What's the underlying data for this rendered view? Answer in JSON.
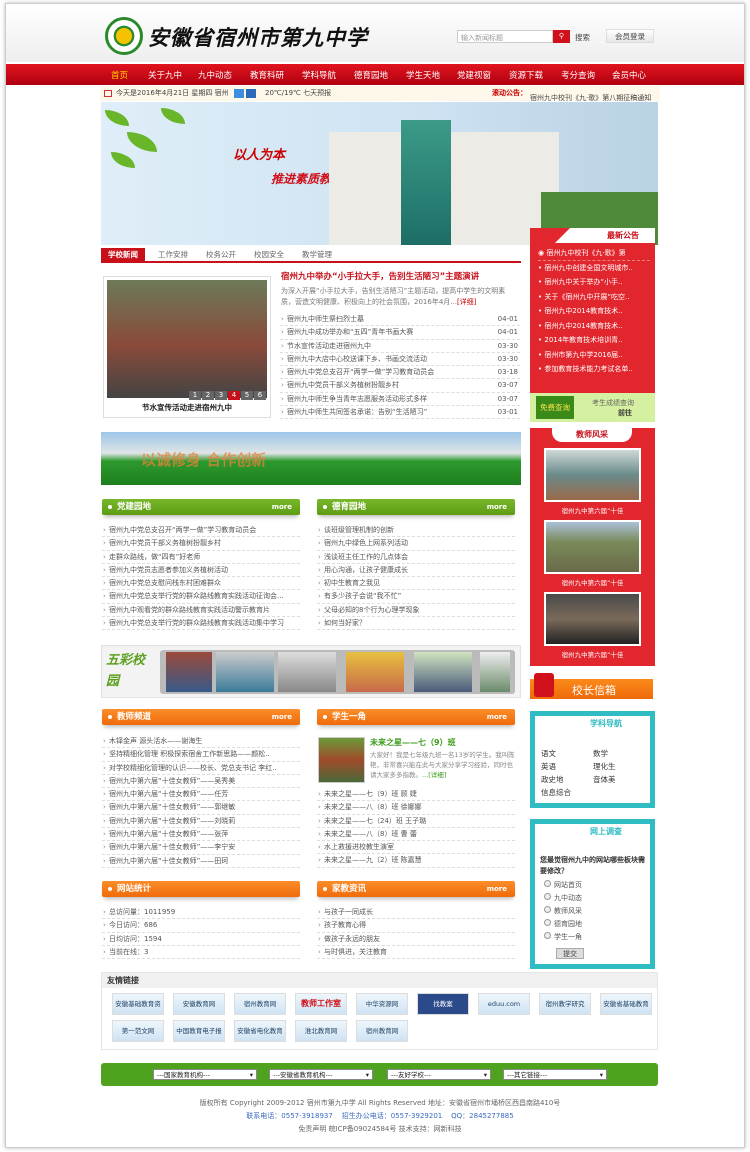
{
  "header": {
    "school_name": "安徽省宿州市第九中学",
    "search_placeholder": "输入新闻标题",
    "search_button": "搜索",
    "login": "会员登录"
  },
  "nav": [
    "首页",
    "关于九中",
    "九中动态",
    "教育科研",
    "学科导航",
    "德育园地",
    "学生天地",
    "党建视窗",
    "资源下载",
    "考分查询",
    "会员中心"
  ],
  "infobar": {
    "date_weather": "今天是2016年4月21日 星期四 宿州",
    "temp": "20℃/19℃ 七天预报",
    "notice_label": "滚动公告：",
    "notice_text": "宿州九中校刊《九·歌》第八期征稿通知"
  },
  "banner": {
    "slogan1": "以人为本",
    "slogan2": "推进素质教育"
  },
  "news": {
    "tabs": [
      "学校新闻",
      "工作安排",
      "校务公开",
      "校园安全",
      "教学管理"
    ],
    "photo_caption": "节水宣传活动走进宿州九中",
    "pager": [
      "1",
      "2",
      "3",
      "4",
      "5",
      "6"
    ],
    "pager_active": 4,
    "headline": "宿州九中举办“小手拉大手，告别生活陋习”主题演讲",
    "summary": "为深入开展“小手拉大手，告别生活陋习”主题活动，提高中学生的文明素质，营造文明健康、积极向上的社会氛围，2016年4月...",
    "detail": "[详细]",
    "items": [
      {
        "t": "宿州九中师生祭扫烈士墓",
        "d": "04-01"
      },
      {
        "t": "宿州九中成功举办和“五四”青年书画大赛",
        "d": "04-01"
      },
      {
        "t": "节水宣传活动走进宿州九中",
        "d": "03-30"
      },
      {
        "t": "宿州九中大店中心校送课下乡、书画交流活动",
        "d": "03-30"
      },
      {
        "t": "宿州九中党总支召开“两学一做”学习教育动员会",
        "d": "03-18"
      },
      {
        "t": "宿州九中党员干部义务植树扮靓乡村",
        "d": "03-07"
      },
      {
        "t": "宿州九中师生争当青年志愿服务活动形式多样",
        "d": "03-07"
      },
      {
        "t": "宿州九中师生共同签名承诺：告别“生活陋习”",
        "d": "03-01"
      }
    ]
  },
  "strip_slogan": "以诚修身 合作创新",
  "party": {
    "title": "党建园地",
    "more": "more",
    "items": [
      "宿州九中党总支召开“两学一做”学习教育动员会",
      "宿州九中党员干部义务植树扮靓乡村",
      "走群众路线，做“四有”好老师",
      "宿州九中党员志愿者参加义务植树活动",
      "宿州九中党总支慰问栈东村困难群众",
      "宿州九中党总支举行党的群众路线教育实践活动征询会...",
      "宿州九中观看党的群众路线教育实践活动警示教育片",
      "宿州九中党总支举行党的群众路线教育实践活动集中学习"
    ]
  },
  "moral": {
    "title": "德育园地",
    "more": "more",
    "items": [
      "谈班级管理机制的创新",
      "宿州九中绿色上网系列活动",
      "浅谈班主任工作的几点体会",
      "用心沟通，让孩子健康成长",
      "初中生教育之我见",
      "有多少孩子会说“我不忙”",
      "父母必知的8个行为心理学现象",
      "如何当好家？"
    ]
  },
  "campus_label": "五彩校园",
  "teachers": {
    "title": "教师频道",
    "more": "more",
    "items": [
      "木铎金声 源头活水——谢海生",
      "坚持精细化管理 积极探索宿舍工作新思路——颜松..",
      "对学校精细化管理的认识——校长、党总支书记 李红..",
      "宿州九中第六届“十佳女教师”——吴秀美",
      "宿州九中第六届“十佳女教师”——任芳",
      "宿州九中第六届“十佳女教师”——郭继敏",
      "宿州九中第六届“十佳女教师”——刘晓莉",
      "宿州九中第六届“十佳女教师”——张萍",
      "宿州九中第六届“十佳女教师”——李宁安",
      "宿州九中第六届“十佳女教师”——田珂"
    ]
  },
  "students": {
    "title": "学生一角",
    "more": "more",
    "feature_title": "未来之星——七（9）班",
    "feature_text": "大家好！我是七年级九班一名13岁的学生。我叫陈艳，非常喜兴能在此与大家分享学习经验，同时也请大家多多指教。",
    "detail": "...[详细]",
    "items": [
      "未来之星——七（9）班 顾 婕",
      "未来之星——八（8）班 徐娜娜",
      "未来之星——七（24）班 王子璐",
      "未来之星——八（8）班 曹 蕾",
      "水上救援进校教生演室",
      "未来之星——九（2）班 陈嘉慧"
    ]
  },
  "stats": {
    "title": "网站统计",
    "items": [
      "总访问量：1011959",
      "今日访问：686",
      "日均访问：1594",
      "当前在线：3"
    ]
  },
  "parents": {
    "title": "家教资讯",
    "more": "more",
    "items": [
      "与孩子一同成长",
      "孩子教育心得",
      "做孩子永远的朋友",
      "与时俱进，关注教育"
    ]
  },
  "notices": {
    "title": "最新公告",
    "items": [
      "宿州九中校刊《九·歌》第",
      "宿州九中创建全国文明城市..",
      "宿州九中关于举办“小手..",
      "关于《宿州九中开展“吃空..",
      "宿州九中2014教育技术..",
      "宿州九中2014教育技术..",
      "2014年教育技术培训青..",
      "宿州市第九中学2016届..",
      "参加教育技术能力考试名单.."
    ]
  },
  "score_query": {
    "badge": "免费查询",
    "label": "考生成绩查询",
    "go": "前往"
  },
  "teacher_style": {
    "title": "教师风采",
    "captions": [
      "宿州九中第六届“十佳",
      "宿州九中第六届“十佳",
      "宿州九中第六届“十佳"
    ]
  },
  "mailbox": "校长信箱",
  "subjects": {
    "title": "学科导航",
    "items": [
      "语文",
      "数学",
      "英语",
      "理化生",
      "政史地",
      "音体美",
      "信息综合"
    ]
  },
  "survey": {
    "title": "网上调查",
    "question": "您最觉宿州九中的网站哪些板块需要修改？",
    "options": [
      "网站首页",
      "九中动态",
      "教师风采",
      "德育园地",
      "学生一角"
    ],
    "submit": "提交"
  },
  "links": {
    "title": "友情链接",
    "items": [
      "安徽基础教育资源",
      "安徽教育网",
      "宿州教育网",
      "教师工作室",
      "中华资源网",
      "找教案",
      "eduu.com",
      "宿州教学研究",
      "安徽省基础教育资源",
      "第一范文网",
      "中国教育电子报刊",
      "安徽省电化教育",
      "淮北教育网",
      "宿州教育网"
    ]
  },
  "selects": [
    "---国家教育机构---",
    "---安徽省教育机构---",
    "---友好学校---",
    "---其它链接---"
  ],
  "footer": {
    "line1": "版权所有 Copyright 2009-2012 宿州市第九中学 All Rights Reserved 地址：安徽省宿州市埇桥区西昌南路410号",
    "phone": "联系电话：0557-3918937",
    "enroll": "招生办公电话：0557-3929201",
    "qq": "QQ：2845277885",
    "line3": "免责声明 皖ICP备09024584号 技术支持：网新科技"
  }
}
